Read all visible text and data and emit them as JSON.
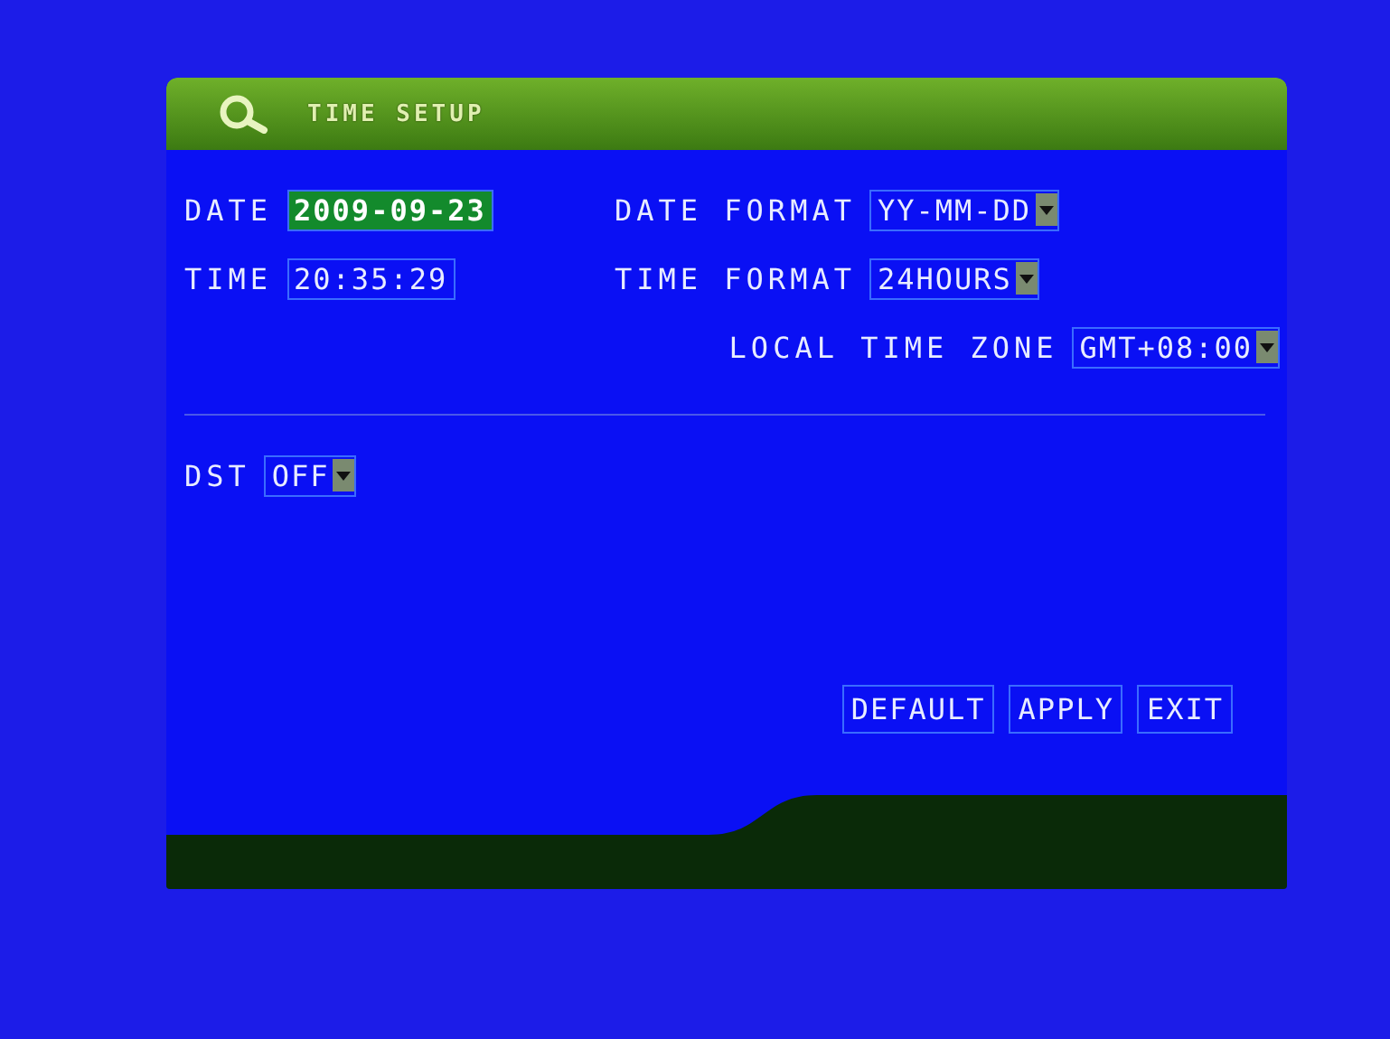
{
  "window": {
    "title": "TIME SETUP"
  },
  "rows": [
    {
      "kind": "pair",
      "items": [
        {
          "kind": "text",
          "label": "DATE",
          "value": "2009-09-23",
          "selected": true
        },
        {
          "kind": "dropdown",
          "label": "DATE FORMAT",
          "value": "YY-MM-DD",
          "selected": false
        }
      ]
    },
    {
      "kind": "pair",
      "items": [
        {
          "kind": "text",
          "label": "TIME",
          "value": "20:35:29",
          "selected": false
        },
        {
          "kind": "dropdown",
          "label": "TIME FORMAT",
          "value": "24HOURS",
          "selected": false
        }
      ]
    },
    {
      "kind": "single",
      "items": [
        {
          "kind": "dropdown",
          "label": "LOCAL TIME ZONE",
          "value": "GMT+08:00",
          "selected": false
        }
      ]
    }
  ],
  "dst": {
    "kind": "dropdown",
    "label": "DST",
    "value": "OFF",
    "selected": false
  },
  "buttons": [
    "DEFAULT",
    "APPLY",
    "EXIT"
  ]
}
